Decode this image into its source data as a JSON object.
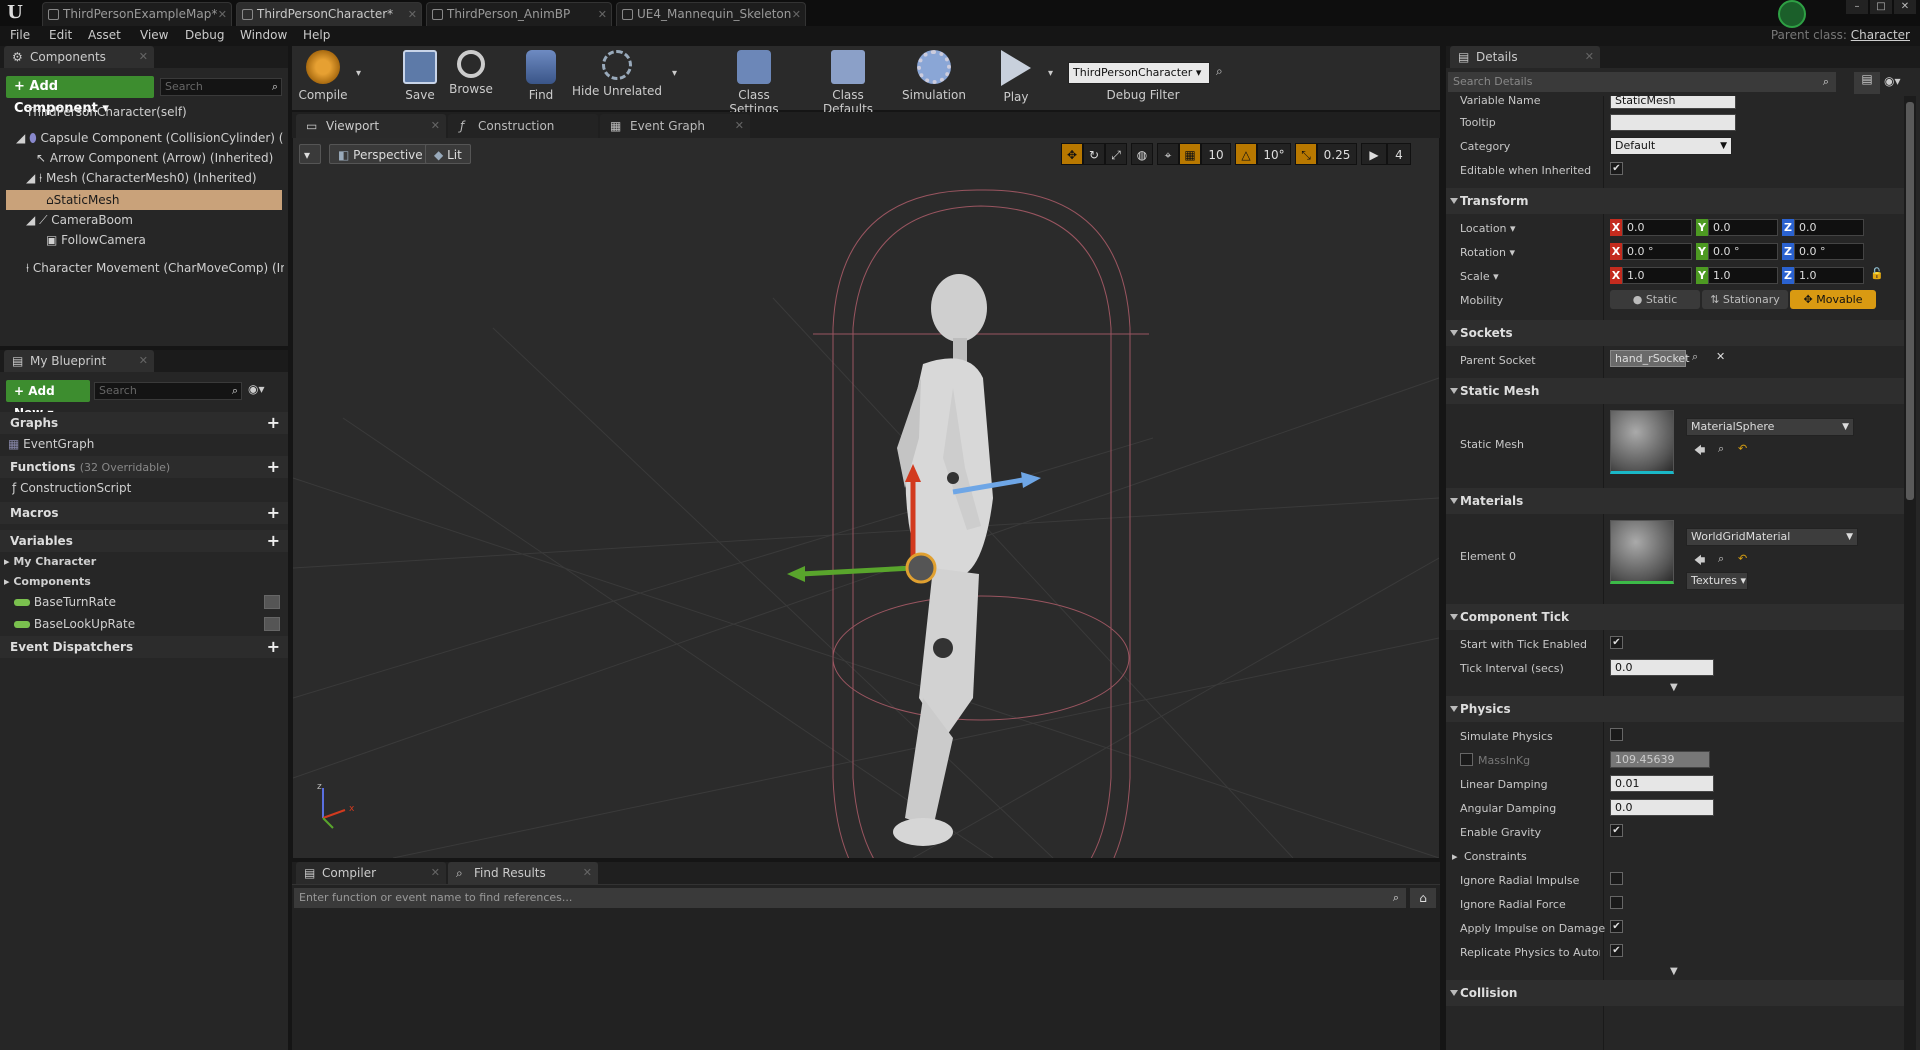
{
  "titlebar": {
    "tabs": [
      {
        "label": "ThirdPersonExampleMap*"
      },
      {
        "label": "ThirdPersonCharacter*"
      },
      {
        "label": "ThirdPerson_AnimBP"
      },
      {
        "label": "UE4_Mannequin_Skeleton"
      }
    ],
    "parent_class_prefix": "Parent class:",
    "parent_class_value": "Character"
  },
  "menu": [
    "File",
    "Edit",
    "Asset",
    "View",
    "Debug",
    "Window",
    "Help"
  ],
  "components": {
    "title": "Components",
    "add_label": "+ Add Component ▾",
    "search_placeholder": "Search",
    "items": [
      "ThirdPersonCharacter(self)",
      "Capsule Component (CollisionCylinder) (Inherited)",
      "Arrow Component (Arrow) (Inherited)",
      "Mesh (CharacterMesh0) (Inherited)",
      "StaticMesh",
      "CameraBoom",
      "FollowCamera",
      "Character Movement (CharMoveComp) (Inherited)"
    ]
  },
  "blueprint": {
    "title": "My Blueprint",
    "add_label": "+ Add New ▾",
    "search_placeholder": "Search",
    "graphs_label": "Graphs",
    "event_graph": "EventGraph",
    "functions_label": "Functions",
    "functions_count": "(32 Overridable)",
    "construction_script": "ConstructionScript",
    "macros_label": "Macros",
    "variables_label": "Variables",
    "my_character": "My Character",
    "components_cat": "Components",
    "var1": "BaseTurnRate",
    "var2": "BaseLookUpRate",
    "event_dispatchers": "Event Dispatchers"
  },
  "toolbar": {
    "compile": "Compile",
    "save": "Save",
    "browse": "Browse",
    "find": "Find",
    "hide_unrelated": "Hide Unrelated",
    "class_settings": "Class Settings",
    "class_defaults": "Class Defaults",
    "simulation": "Simulation",
    "play": "Play",
    "debug_object": "ThirdPersonCharacter ▾",
    "debug_filter": "Debug Filter"
  },
  "viewport_tabs": [
    "Viewport",
    "Construction Scrip",
    "Event Graph"
  ],
  "viewport": {
    "perspective": "Perspective",
    "lit": "Lit",
    "snap_grid": "10",
    "snap_rot": "10°",
    "snap_scale": "0.25",
    "cam_speed": "4",
    "axis_z": "z",
    "axis_x": "x"
  },
  "bottom": {
    "tab1": "Compiler Results",
    "tab2": "Find Results",
    "find_placeholder": "Enter function or event name to find references..."
  },
  "details": {
    "title": "Details",
    "search_placeholder": "Search Details",
    "variable_name_label": "Variable Name",
    "variable_name_value": "StaticMesh",
    "tooltip_label": "Tooltip",
    "category_label": "Category",
    "category_value": "Default",
    "editable_label": "Editable when Inherited",
    "transform": "Transform",
    "location": "Location ▾",
    "rotation": "Rotation ▾",
    "scale": "Scale ▾",
    "loc": [
      "0.0",
      "0.0",
      "0.0"
    ],
    "rot": [
      "0.0 °",
      "0.0 °",
      "0.0 °"
    ],
    "scl": [
      "1.0",
      "1.0",
      "1.0"
    ],
    "mobility": "Mobility",
    "mob_static": "Static",
    "mob_stationary": "Stationary",
    "mob_movable": "Movable",
    "sockets": "Sockets",
    "parent_socket": "Parent Socket",
    "parent_socket_value": "hand_rSocket",
    "static_mesh_sec": "Static Mesh",
    "static_mesh_label": "Static Mesh",
    "static_mesh_value": "MaterialSphere",
    "materials": "Materials",
    "element0": "Element 0",
    "element0_value": "WorldGridMaterial",
    "textures": "Textures ▾",
    "component_tick": "Component Tick",
    "start_tick": "Start with Tick Enabled",
    "tick_interval": "Tick Interval (secs)",
    "tick_interval_value": "0.0",
    "physics": "Physics",
    "simulate_physics": "Simulate Physics",
    "mass": "MassInKg",
    "mass_value": "109.45639",
    "linear_damping": "Linear Damping",
    "linear_damping_value": "0.01",
    "angular_damping": "Angular Damping",
    "angular_damping_value": "0.0",
    "enable_gravity": "Enable Gravity",
    "constraints": "Constraints",
    "ignore_radial_impulse": "Ignore Radial Impulse",
    "ignore_radial_force": "Ignore Radial Force",
    "apply_impulse": "Apply Impulse on Damage",
    "replicate_physics": "Replicate Physics to Autonomous Proxy",
    "collision": "Collision"
  },
  "colors": {
    "accent_orange": "#b87800",
    "green": "#3d8d2f",
    "selection": "#c9a27a"
  }
}
